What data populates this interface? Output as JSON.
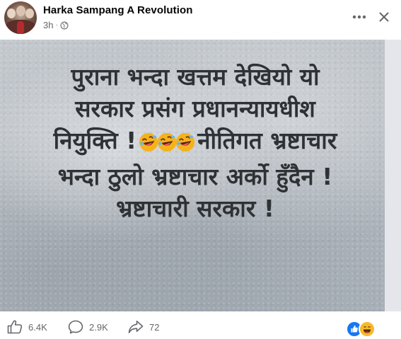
{
  "post": {
    "author": "Harka Sampang A Revolution",
    "time": "3h",
    "separator": "·",
    "privacy_icon": "globe-icon"
  },
  "quote": {
    "line1": "पुराना भन्दा खत्तम देखियो यो",
    "line2": "सरकार प्रसंग प्रधानन्यायधीश",
    "line3_before": "नियुक्ति !",
    "line3_emoji": [
      "rolling-laughing-icon",
      "rolling-laughing-icon",
      "rolling-laughing-icon"
    ],
    "line3_after": "नीतिगत भ्रष्टाचार",
    "line4": "भन्दा ठुलो भ्रष्टाचार अर्को हुँदैन !",
    "line5": "भ्रष्टाचारी सरकार !"
  },
  "footer": {
    "likes": "6.4K",
    "comments": "2.9K",
    "shares": "72",
    "reaction_icons": [
      "like-reaction-icon",
      "laugh-reaction-icon"
    ]
  },
  "colors": {
    "author_text": "#050505",
    "meta_text": "#65676b",
    "quote_text": "#2f3235",
    "like_blue": "#1877f2",
    "laugh_yellow": "#f7b928"
  }
}
